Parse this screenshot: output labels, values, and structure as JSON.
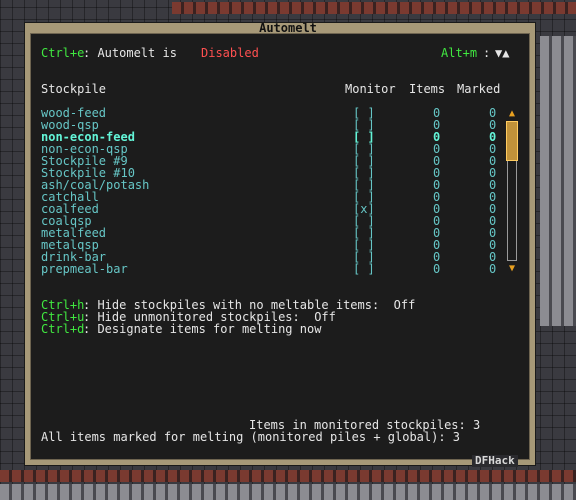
{
  "window": {
    "title": "Automelt",
    "watermark": "DFHack"
  },
  "header": {
    "toggle_key": "Ctrl+e",
    "toggle_text": ": Automelt is ",
    "status": "Disabled",
    "sort_key": "Alt+m",
    "sort_arrows": "▼▲"
  },
  "columns": {
    "stockpile": "Stockpile",
    "monitor": "Monitor",
    "items": "Items",
    "marked": "Marked"
  },
  "rows": [
    {
      "name": "wood-feed",
      "monitor": "[ ]",
      "items": "0",
      "marked": "0",
      "selected": false
    },
    {
      "name": "wood-qsp",
      "monitor": "[ ]",
      "items": "0",
      "marked": "0",
      "selected": false
    },
    {
      "name": "non-econ-feed",
      "monitor": "[ ]",
      "items": "0",
      "marked": "0",
      "selected": true
    },
    {
      "name": "non-econ-qsp",
      "monitor": "[ ]",
      "items": "0",
      "marked": "0",
      "selected": false
    },
    {
      "name": "Stockpile #9",
      "monitor": "[ ]",
      "items": "0",
      "marked": "0",
      "selected": false
    },
    {
      "name": "Stockpile #10",
      "monitor": "[ ]",
      "items": "0",
      "marked": "0",
      "selected": false
    },
    {
      "name": "ash/coal/potash",
      "monitor": "[ ]",
      "items": "0",
      "marked": "0",
      "selected": false
    },
    {
      "name": "catchall",
      "monitor": "[ ]",
      "items": "0",
      "marked": "0",
      "selected": false
    },
    {
      "name": "coalfeed",
      "monitor": "[x]",
      "items": "0",
      "marked": "0",
      "selected": false
    },
    {
      "name": "coalqsp",
      "monitor": "[ ]",
      "items": "0",
      "marked": "0",
      "selected": false
    },
    {
      "name": "metalfeed",
      "monitor": "[ ]",
      "items": "0",
      "marked": "0",
      "selected": false
    },
    {
      "name": "metalqsp",
      "monitor": "[ ]",
      "items": "0",
      "marked": "0",
      "selected": false
    },
    {
      "name": "drink-bar",
      "monitor": "[ ]",
      "items": "0",
      "marked": "0",
      "selected": false
    },
    {
      "name": "prepmeal-bar",
      "monitor": "[ ]",
      "items": "0",
      "marked": "0",
      "selected": false
    }
  ],
  "options": [
    {
      "key": "Ctrl+h",
      "text": ": Hide stockpiles with no meltable items:  Off"
    },
    {
      "key": "Ctrl+u",
      "text": ": Hide unmonitored stockpiles:  Off"
    },
    {
      "key": "Ctrl+d",
      "text": ": Designate items for melting now"
    }
  ],
  "footer": {
    "monitored_label": "Items in monitored stockpiles: 3",
    "all_label": "All items marked for melting (monitored piles + global): 3"
  },
  "colors": {
    "key": "#40e840",
    "accent": "#66c6c6",
    "selected": "#63f5d8",
    "disabled": "#ff5050"
  }
}
